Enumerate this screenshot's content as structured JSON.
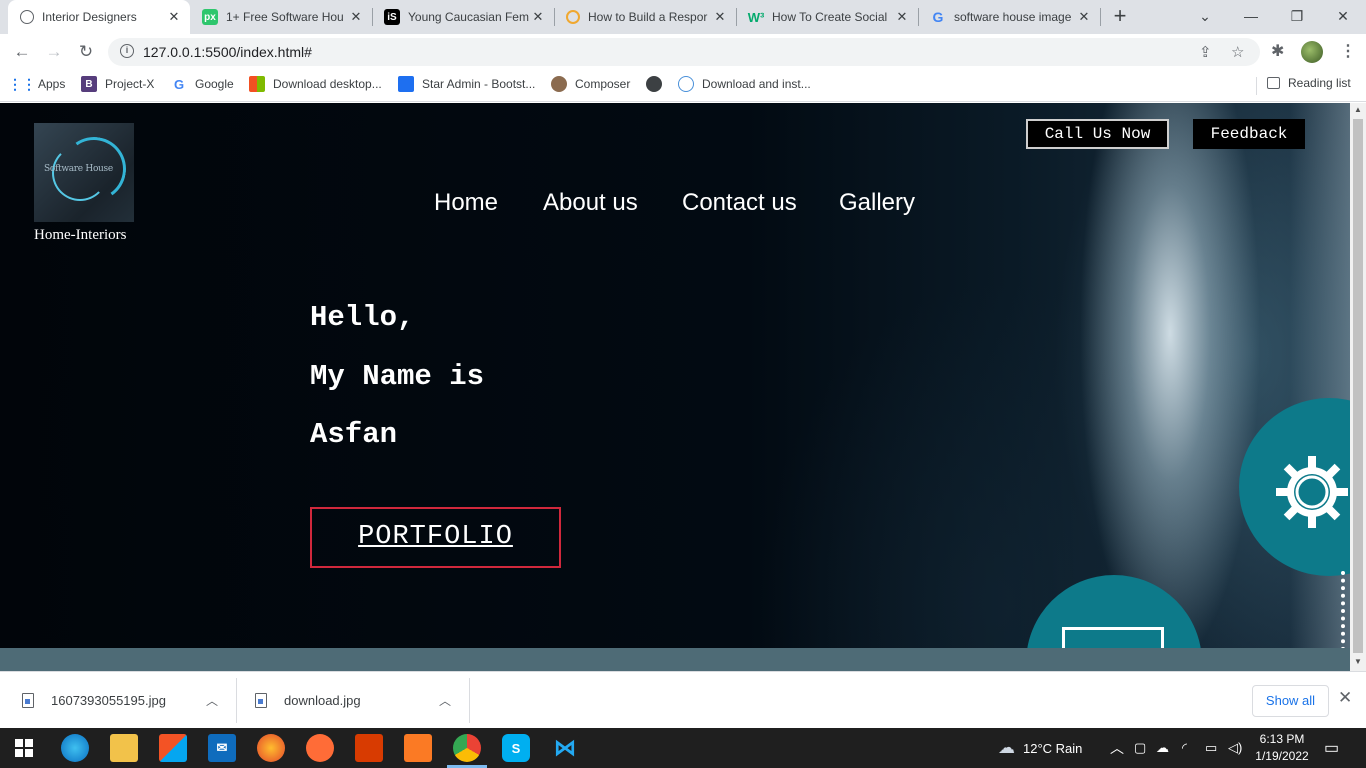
{
  "browser": {
    "tabs": [
      {
        "label": "Interior Designers",
        "icon": "globe-icon",
        "active": true
      },
      {
        "label": "1+ Free Software Hou",
        "icon": "pixabay-icon",
        "active": false
      },
      {
        "label": "Young Caucasian Fem",
        "icon": "istock-icon",
        "active": false
      },
      {
        "label": "How to Build a Respor",
        "icon": "loading-icon",
        "active": false
      },
      {
        "label": "How To Create Social",
        "icon": "w3-icon",
        "active": false
      },
      {
        "label": "software house image",
        "icon": "google-icon",
        "active": false
      }
    ],
    "new_tab": "+",
    "window_controls": {
      "dropdown": "⌄",
      "minimize": "—",
      "maximize": "❐",
      "close": "✕"
    },
    "address": {
      "url": "127.0.0.1:5500/index.html#",
      "info": "i"
    },
    "bookmarks": [
      {
        "label": "Apps",
        "icon": "apps-grid-icon"
      },
      {
        "label": "Project-X",
        "icon": "bootstrap-icon"
      },
      {
        "label": "Google",
        "icon": "google-icon"
      },
      {
        "label": "Download desktop...",
        "icon": "windows-icon"
      },
      {
        "label": "Star Admin - Bootst...",
        "icon": "star-admin-icon"
      },
      {
        "label": "Composer",
        "icon": "composer-icon"
      },
      {
        "label": "",
        "icon": "globe-icon"
      },
      {
        "label": "Download and inst...",
        "icon": "web-icon"
      }
    ],
    "reading_list": "Reading list"
  },
  "site": {
    "logo_text": "Software House",
    "logo_caption": "Home-Interiors",
    "call_button": "Call Us Now",
    "feedback_button": "Feedback",
    "nav": [
      "Home",
      "About us",
      "Contact us",
      "Gallery"
    ],
    "greeting": [
      "Hello,",
      "My Name is",
      "Asfan"
    ],
    "portfolio_button": "PORTFOLIO"
  },
  "downloads": {
    "items": [
      "1607393055195.jpg",
      "download.jpg"
    ],
    "show_all": "Show all"
  },
  "taskbar": {
    "apps": [
      "start-icon",
      "edge-icon",
      "file-explorer-icon",
      "store-icon",
      "mail-icon",
      "firefox-icon",
      "postman-icon",
      "office-icon",
      "xampp-icon",
      "chrome-icon",
      "skype-icon",
      "vscode-icon"
    ],
    "weather": "12°C  Rain",
    "time": "6:13 PM",
    "date": "1/19/2022"
  },
  "colors": {
    "accent_teal": "#0d7a8a",
    "portfolio_border": "#d0283c",
    "page_bg": "#02070c"
  }
}
